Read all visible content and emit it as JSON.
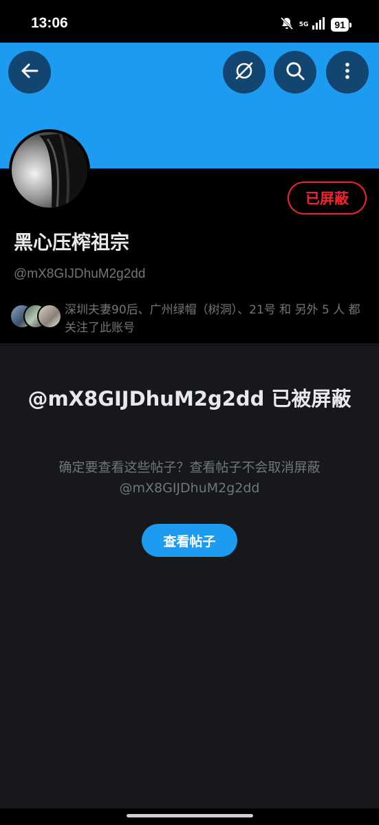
{
  "status_bar": {
    "time": "13:06",
    "network": "5G",
    "battery": "91",
    "icons": [
      "mute-icon",
      "signal-icon",
      "battery-icon"
    ]
  },
  "header": {
    "back_icon": "arrow-left-icon",
    "grok_icon": "grok-icon",
    "search_icon": "search-icon",
    "more_icon": "more-vertical-icon",
    "banner_color": "#1d9bf0"
  },
  "profile": {
    "display_name": "黑心压榨祖宗",
    "handle": "@mX8GIJDhuM2g2dd",
    "blocked_label": "已屏蔽",
    "followers_text": "深圳夫妻90后、广州绿帽（树洞）、21号 和 另外 5 人 都关注了此账号"
  },
  "blocked_notice": {
    "title": "@mX8GIJDhuM2g2dd 已被屏蔽",
    "description": "确定要查看这些帖子？查看帖子不会取消屏蔽@mX8GIJDhuM2g2dd",
    "view_button": "查看帖子"
  },
  "colors": {
    "accent": "#1d9bf0",
    "blocked_red": "#f4212e",
    "muted_text": "#71767b",
    "panel_bg": "#16181c"
  }
}
